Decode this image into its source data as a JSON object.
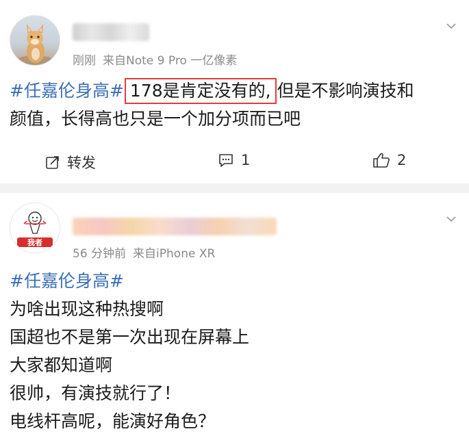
{
  "post1": {
    "time": "刚刚",
    "source": "来自Note 9 Pro 一亿像素",
    "hashtag": "#任嘉伦身高#",
    "highlight": "178是肯定没有的,",
    "text_line1_rest": "但是不影响演技和",
    "text_line2": "颜值，长得高也只是一个加分项而已吧",
    "actions": {
      "repost_label": "转发",
      "comment_count": "1",
      "like_count": "2"
    }
  },
  "post2": {
    "avatar_caption": "我者",
    "time": "56 分钟前",
    "source": "来自iPhone XR",
    "hashtag": "#任嘉伦身高#",
    "lines": [
      "为啥出现这种热搜啊",
      "国超也不是第一次出现在屏幕上",
      "大家都知道啊",
      "很帅，有演技就行了！",
      "电线杆高呢，能演好角色？"
    ]
  },
  "colors": {
    "hashtag": "#3b6fb6",
    "highlight_border": "#e23b3b",
    "meta_text": "#8a8a8a",
    "separator": "#f2f2f2"
  }
}
